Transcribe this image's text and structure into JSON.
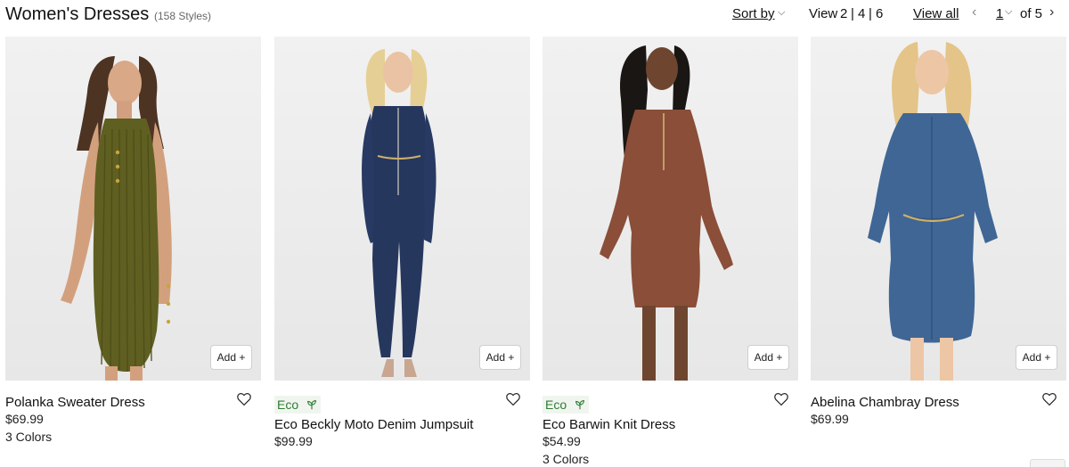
{
  "header": {
    "title": "Women's Dresses",
    "count": "(158 Styles)",
    "sort_label": "Sort by",
    "view_label": "View",
    "view_options": [
      "2",
      "4",
      "6"
    ],
    "view_all_label": "View all",
    "page_current": "1",
    "page_of": "of 5"
  },
  "icons": {
    "sort": "chevron-down-icon",
    "prev": "chevron-left-icon",
    "next": "chevron-right-icon",
    "wishlist": "heart-icon",
    "eco": "leaf-icon"
  },
  "colors": {
    "eco_green": "#2e7d32",
    "eco_bg": "#f1f5ef"
  },
  "products": [
    {
      "name": "Polanka Sweater Dress",
      "price": "$69.99",
      "colors": "3 Colors",
      "badge": "",
      "add_label": "Add +"
    },
    {
      "name": "Eco Beckly Moto Denim Jumpsuit",
      "price": "$99.99",
      "colors": "",
      "badge": "Eco",
      "add_label": "Add +"
    },
    {
      "name": "Eco Barwin Knit Dress",
      "price": "$54.99",
      "colors": "3 Colors",
      "badge": "Eco",
      "add_label": "Add +"
    },
    {
      "name": "Abelina Chambray Dress",
      "price": "$69.99",
      "colors": "",
      "badge": "",
      "add_label": "Add +"
    }
  ]
}
